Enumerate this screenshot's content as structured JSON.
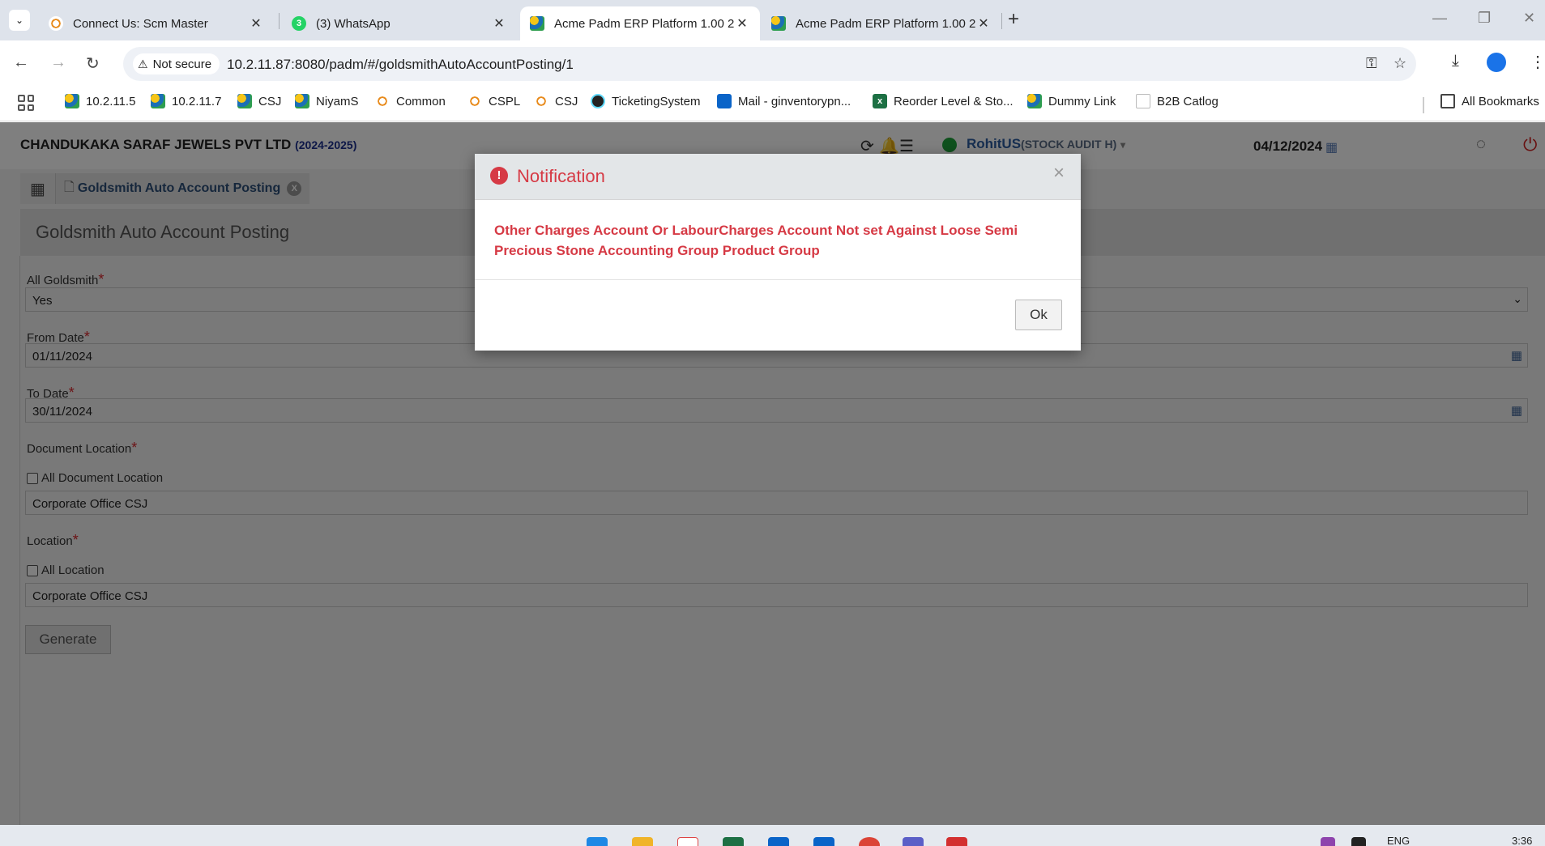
{
  "browser": {
    "tabs": [
      {
        "title": "Connect Us: Scm Master",
        "favicon": "jeweller-logo-icon",
        "active": false
      },
      {
        "title": "(3) WhatsApp",
        "favicon": "whatsapp-icon",
        "active": false
      },
      {
        "title": "Acme Padm ERP Platform 1.00 2",
        "favicon": "padm-cog-icon",
        "active": true
      },
      {
        "title": "Acme Padm ERP Platform 1.00 2",
        "favicon": "padm-cog-icon",
        "active": false
      }
    ],
    "security_label": "Not secure",
    "url": "10.2.11.87:8080/padm/#/goldsmithAutoAccountPosting/1",
    "bookmarks": [
      {
        "label": "10.2.11.5",
        "icon": "padm-cog-icon"
      },
      {
        "label": "10.2.11.7",
        "icon": "padm-cog-icon"
      },
      {
        "label": "CSJ",
        "icon": "padm-cog-icon"
      },
      {
        "label": "NiyamS",
        "icon": "padm-cog-icon"
      },
      {
        "label": "Common",
        "icon": "jeweller-logo-icon"
      },
      {
        "label": "CSPL",
        "icon": "jeweller-logo-icon"
      },
      {
        "label": "CSJ",
        "icon": "jeweller-logo-icon"
      },
      {
        "label": "TicketingSystem",
        "icon": "react-icon"
      },
      {
        "label": "Mail - ginventorypn...",
        "icon": "outlook-icon"
      },
      {
        "label": "Reorder Level & Sto...",
        "icon": "excel-icon"
      },
      {
        "label": "Dummy Link",
        "icon": "padm-cog-icon"
      },
      {
        "label": "B2B Catlog",
        "icon": "document-icon"
      }
    ],
    "all_bookmarks_label": "All Bookmarks"
  },
  "header": {
    "company": "CHANDUKAKA SARAF JEWELS PVT LTD",
    "fiscal_year": "(2024-2025)",
    "user": "RohitUS",
    "role": "(STOCK AUDIT H)",
    "date": "04/12/2024"
  },
  "app_tabs": [
    {
      "label": "Goldsmith Auto Account Posting",
      "close_label": "X"
    }
  ],
  "page": {
    "title": "Goldsmith Auto Account Posting",
    "required_mark": "*",
    "fields": {
      "all_goldsmith": {
        "label": "All Goldsmith",
        "value": "Yes"
      },
      "from_date": {
        "label": "From Date",
        "value": "01/11/2024"
      },
      "to_date": {
        "label": "To Date",
        "value": "30/11/2024"
      },
      "document_location": {
        "label": "Document Location",
        "checkbox_label": "All Document Location",
        "checked": false,
        "value": "Corporate Office CSJ"
      },
      "location": {
        "label": "Location",
        "checkbox_label": "All Location",
        "checked": false,
        "value": "Corporate Office CSJ"
      }
    },
    "generate_label": "Generate"
  },
  "modal": {
    "title": "Notification",
    "message": "Other Charges Account Or LabourCharges Account Not set Against Loose Semi Precious Stone Accounting Group Product Group",
    "ok_label": "Ok",
    "close_glyph": "×",
    "color": "#d63a45"
  },
  "taskbar": {
    "language": "ENG",
    "time": "3:36"
  }
}
